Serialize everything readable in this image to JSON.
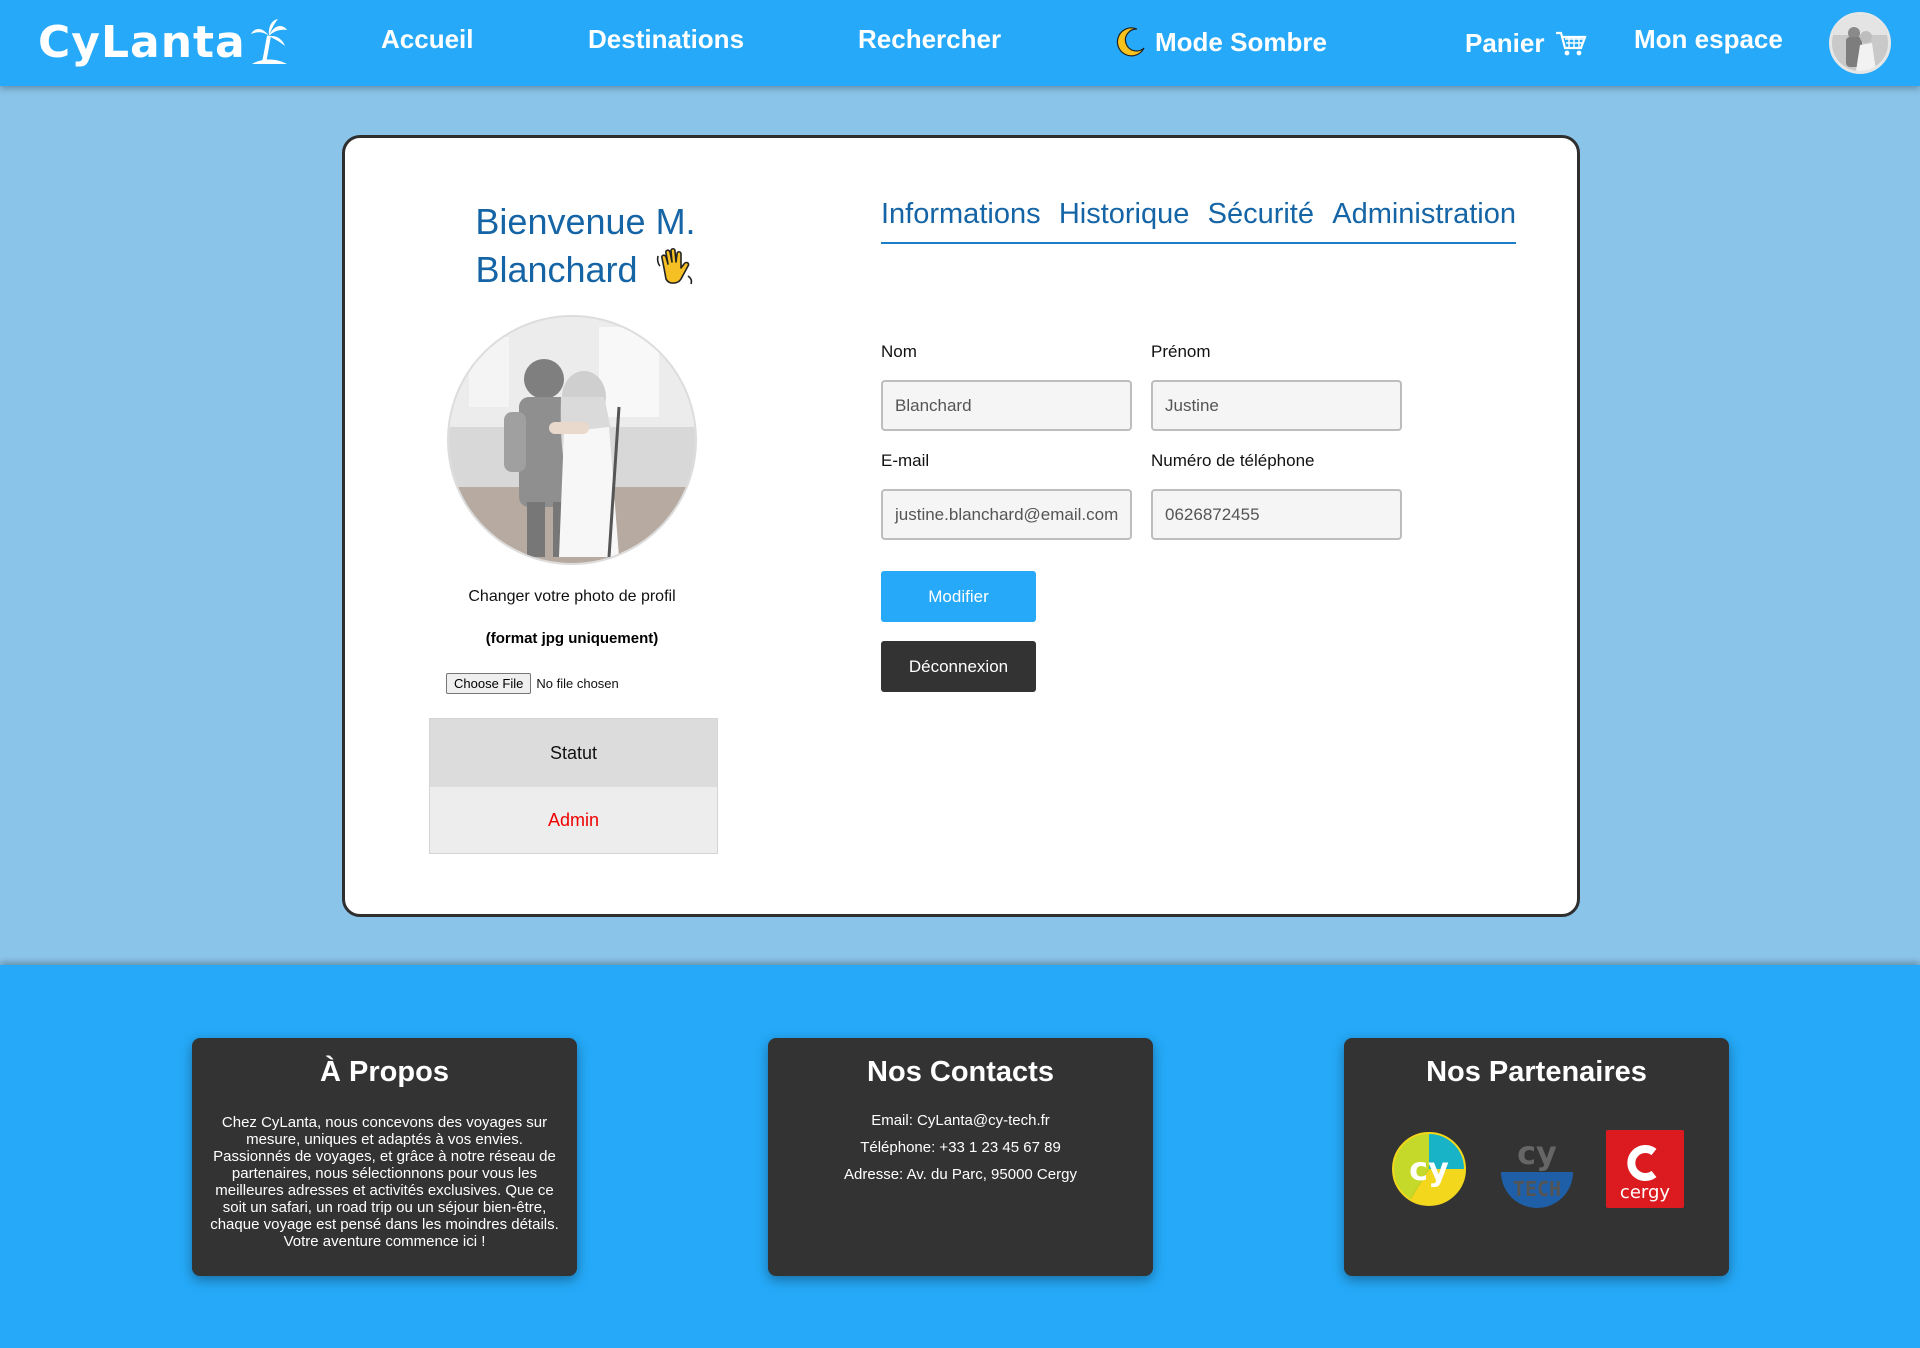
{
  "nav": {
    "logo": "CyLanta",
    "accueil": "Accueil",
    "destinations": "Destinations",
    "rechercher": "Rechercher",
    "mode_sombre": "Mode Sombre",
    "panier": "Panier",
    "mon_espace": "Mon espace"
  },
  "profile": {
    "welcome": "Bienvenue M. Blanchard",
    "change_photo": "Changer votre photo de profil",
    "format": "(format jpg uniquement)",
    "choose_file": "Choose File",
    "no_file": "No file chosen",
    "status_label": "Statut",
    "status_value": "Admin"
  },
  "tabs": [
    "Informations",
    "Historique",
    "Sécurité",
    "Administration"
  ],
  "form": {
    "nom_label": "Nom",
    "nom_value": "Blanchard",
    "prenom_label": "Prénom",
    "prenom_value": "Justine",
    "email_label": "E-mail",
    "email_value": "justine.blanchard@email.com",
    "phone_label": "Numéro de téléphone",
    "phone_value": "0626872455",
    "modify": "Modifier",
    "logout": "Déconnexion"
  },
  "footer": {
    "about_title": "À Propos",
    "about_text": "Chez CyLanta, nous concevons des voyages sur mesure, uniques et adaptés à vos envies. Passionnés de voyages, et grâce à notre réseau de partenaires, nous sélectionnons pour vous les meilleures adresses et activités exclusives. Que ce soit un safari, un road trip ou un séjour bien-être, chaque voyage est pensé dans les moindres détails. Votre aventure commence ici !",
    "contacts_title": "Nos Contacts",
    "email": "Email: CyLanta@cy-tech.fr",
    "phone": "Téléphone: +33 1 23 45 67 89",
    "address": "Adresse: Av. du Parc, 95000 Cergy",
    "partners_title": "Nos Partenaires",
    "partner_logos": [
      "cy-logo",
      "cy-tech-logo",
      "cergy-logo"
    ]
  },
  "colors": {
    "primary": "#25a9f8",
    "background": "#8ac4e9",
    "title_blue": "#1565a6",
    "dark": "#333333",
    "admin_red": "#ee0000"
  }
}
